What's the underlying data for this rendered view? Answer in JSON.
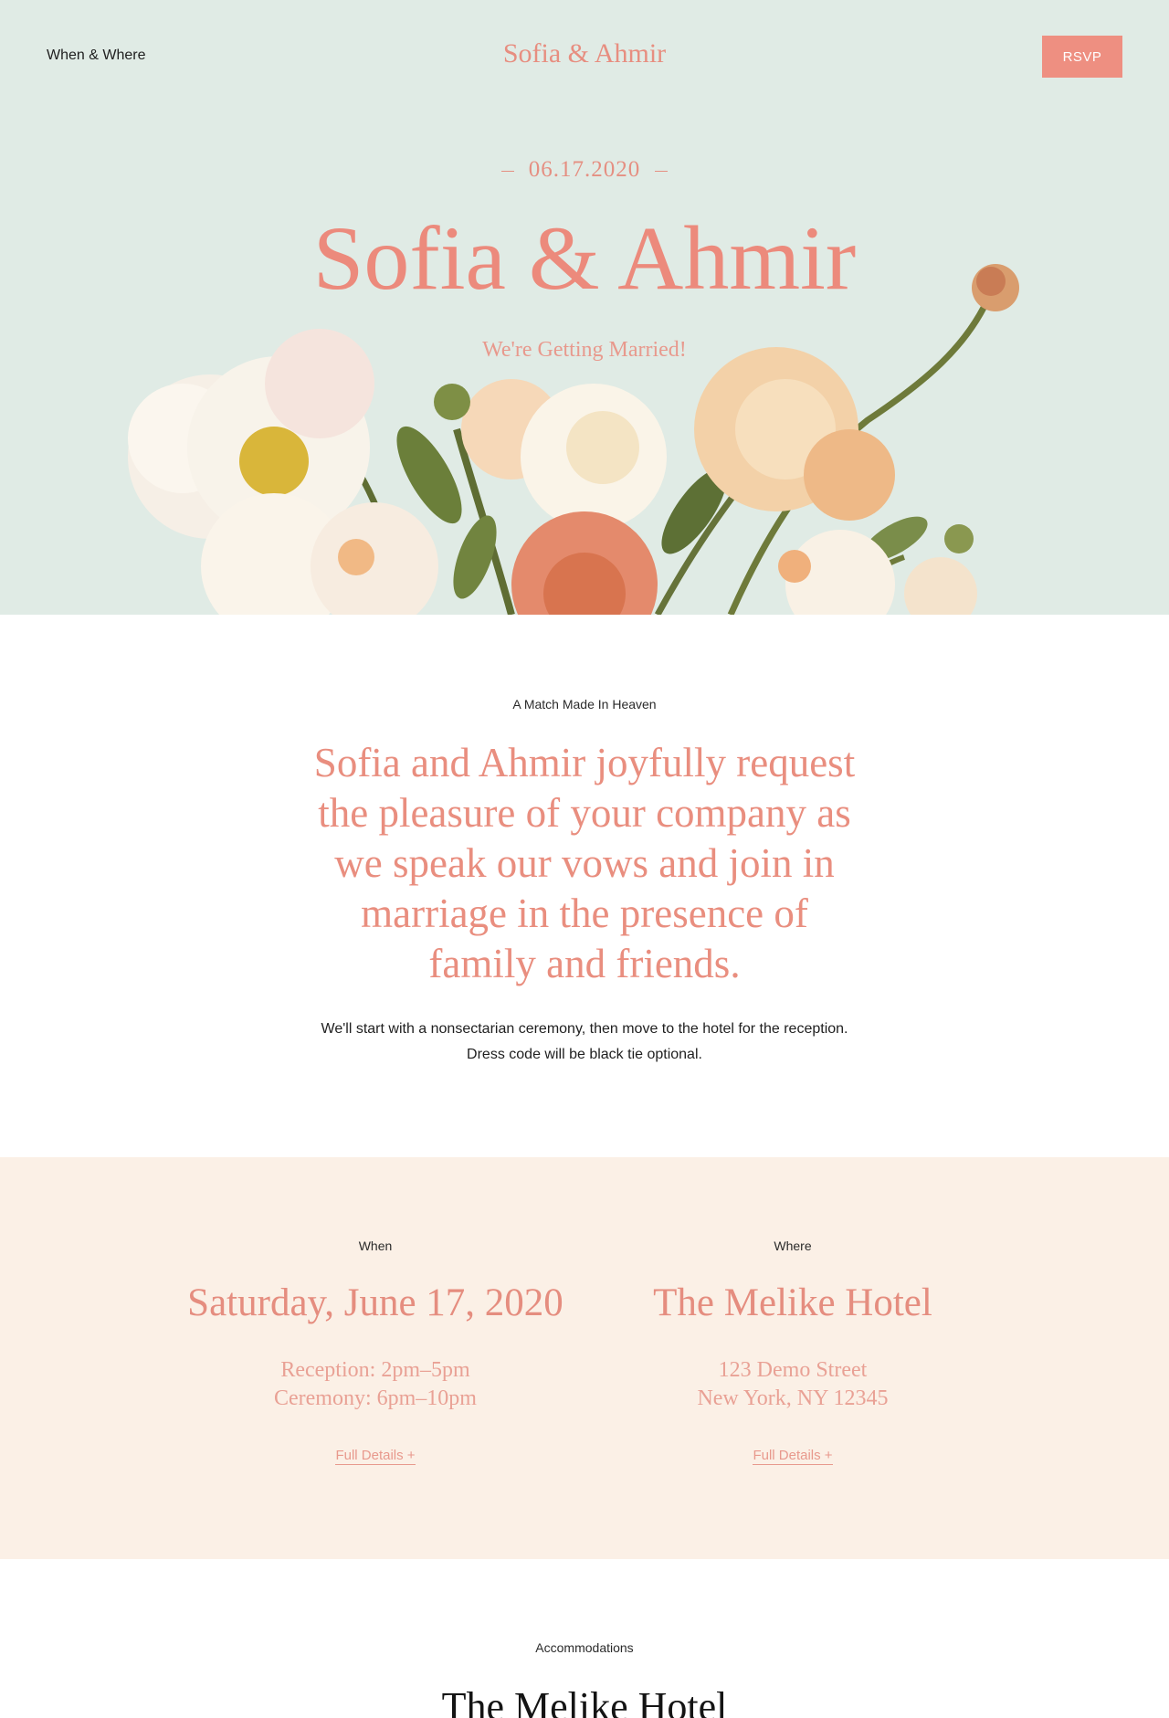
{
  "header": {
    "nav_link": "When & Where",
    "brand": "Sofia & Ahmir",
    "rsvp_label": "RSVP"
  },
  "hero": {
    "date": "06.17.2020",
    "title": "Sofia & Ahmir",
    "tagline": "We're Getting Married!"
  },
  "intro": {
    "eyebrow": "A Match Made In Heaven",
    "heading": "Sofia and Ahmir joyfully request the pleasure of your company as we speak our vows and join in marriage in the presence of family and friends.",
    "body_line1": "We'll start with a nonsectarian ceremony, then move to the hotel for the reception.",
    "body_line2": "Dress code will be black tie optional."
  },
  "details": {
    "when": {
      "eyebrow": "When",
      "title": "Saturday, June 17, 2020",
      "line1": "Reception: 2pm–5pm",
      "line2": "Ceremony: 6pm–10pm",
      "link": "Full Details +"
    },
    "where": {
      "eyebrow": "Where",
      "title": "The Melike Hotel",
      "line1": "123 Demo Street",
      "line2": "New York, NY 12345",
      "link": "Full Details +"
    }
  },
  "accommodations": {
    "eyebrow": "Accommodations",
    "title": "The Melike Hotel"
  },
  "colors": {
    "hero_bg": "#e0ebe5",
    "accent": "#ee8f81",
    "band_bg": "#fbf0e6"
  }
}
